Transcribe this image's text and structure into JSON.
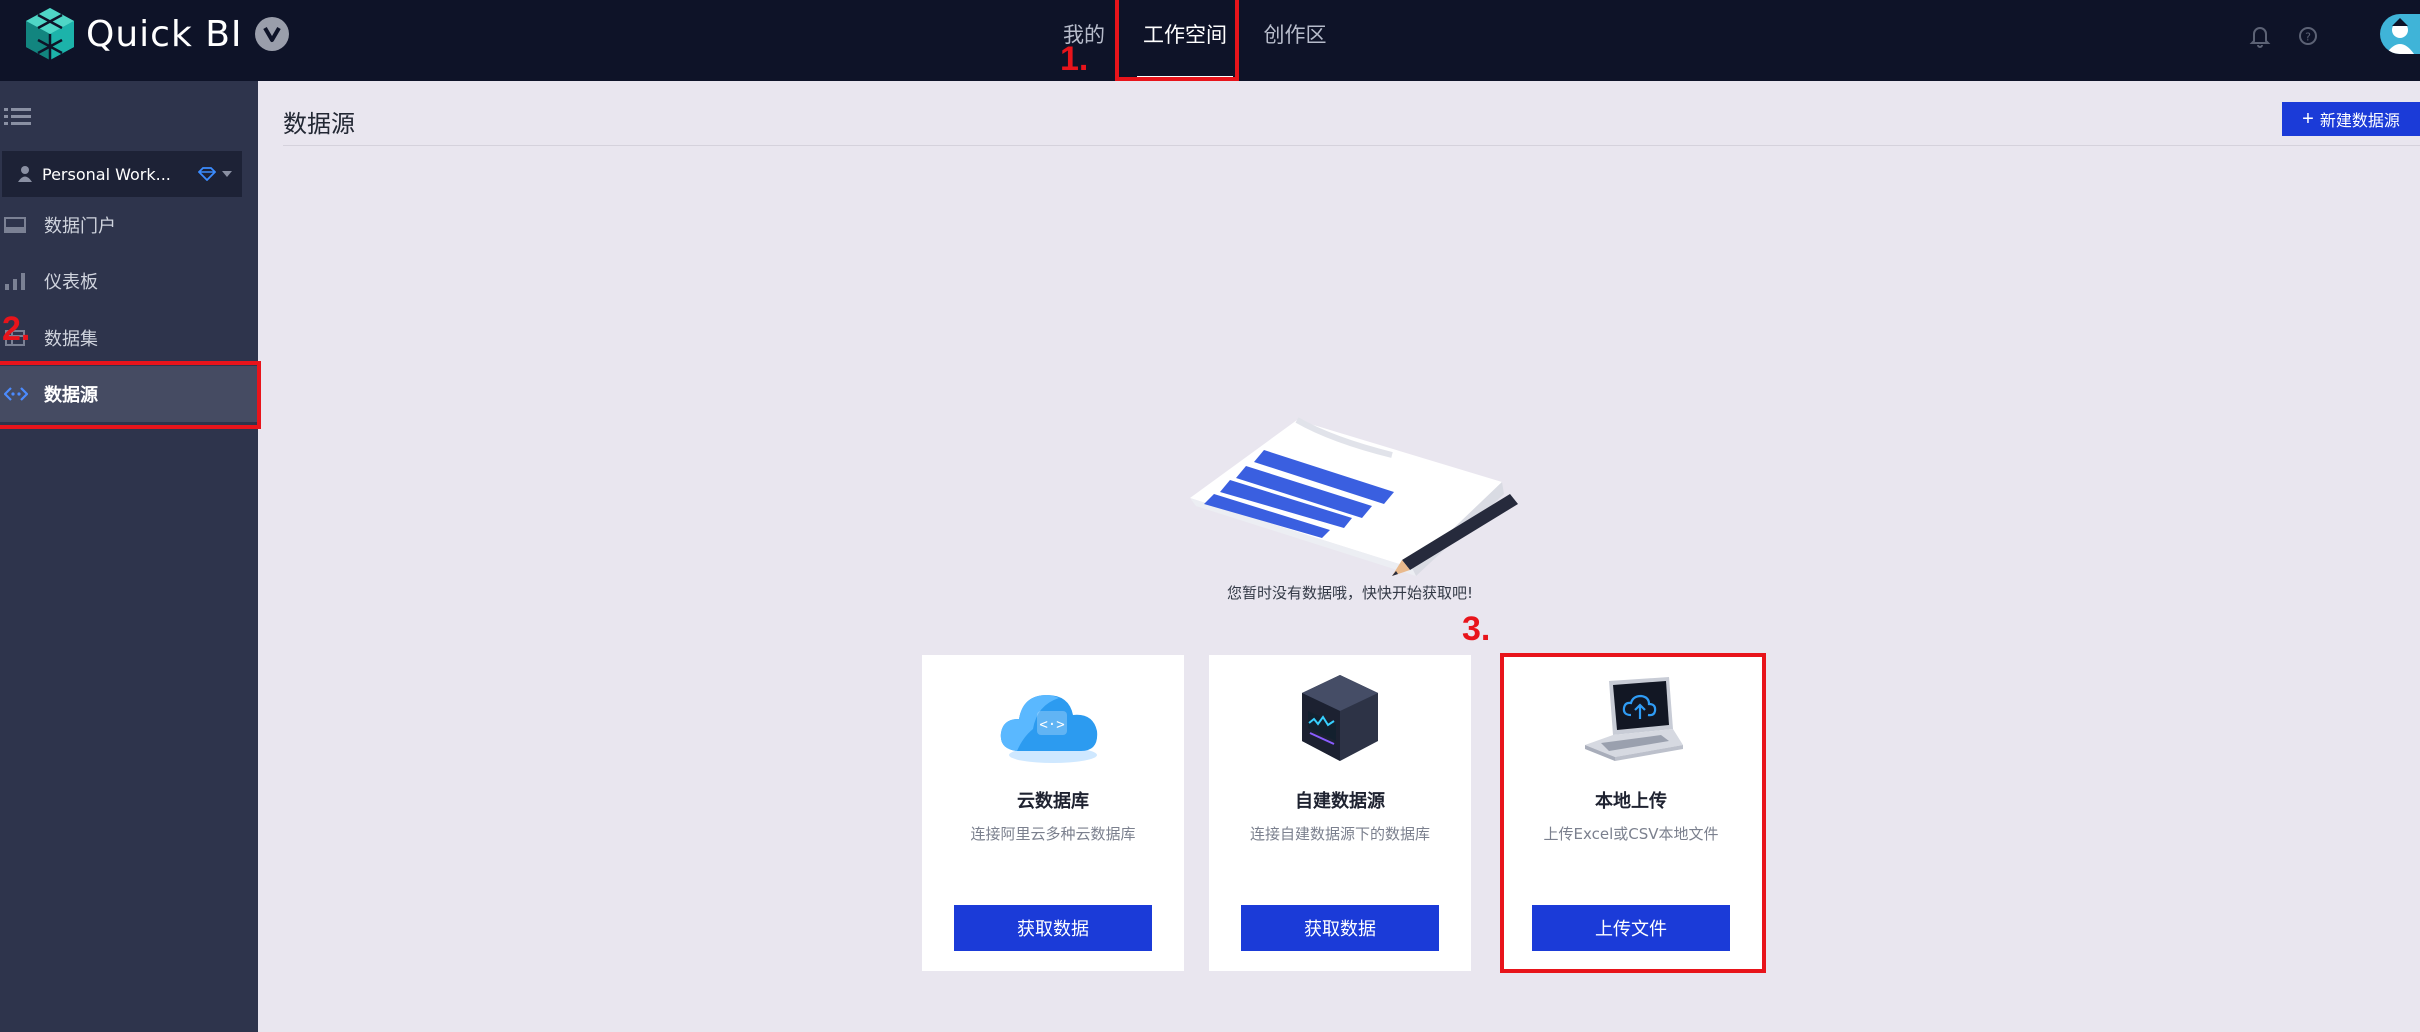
{
  "app": {
    "name": "Quick BI"
  },
  "topnav": {
    "items": [
      {
        "label": "我的"
      },
      {
        "label": "工作空间"
      },
      {
        "label": "创作区"
      }
    ]
  },
  "sidebar": {
    "workspace": "Personal Work...",
    "items": [
      {
        "label": "数据门户",
        "icon": "portal-icon"
      },
      {
        "label": "仪表板",
        "icon": "bar-chart-icon"
      },
      {
        "label": "数据集",
        "icon": "dataset-icon"
      },
      {
        "label": "数据源",
        "icon": "datasource-icon"
      }
    ]
  },
  "main": {
    "title": "数据源",
    "new_button": "新建数据源",
    "empty_text": "您暂时没有数据哦，快快开始获取吧!",
    "cards": [
      {
        "title": "云数据库",
        "desc": "连接阿里云多种云数据库",
        "button": "获取数据",
        "icon": "cloud-database-icon"
      },
      {
        "title": "自建数据源",
        "desc": "连接自建数据源下的数据库",
        "button": "获取数据",
        "icon": "server-icon"
      },
      {
        "title": "本地上传",
        "desc": "上传Excel或CSV本地文件",
        "button": "上传文件",
        "icon": "laptop-upload-icon"
      }
    ]
  },
  "annotations": {
    "step1": "1.",
    "step2": "2.",
    "step3": "3."
  },
  "colors": {
    "topbar": "#0e1328",
    "sidebar": "#2e344c",
    "primary": "#1b3bd8",
    "annotation": "#e8141b",
    "content_bg": "#e9e6ef"
  }
}
